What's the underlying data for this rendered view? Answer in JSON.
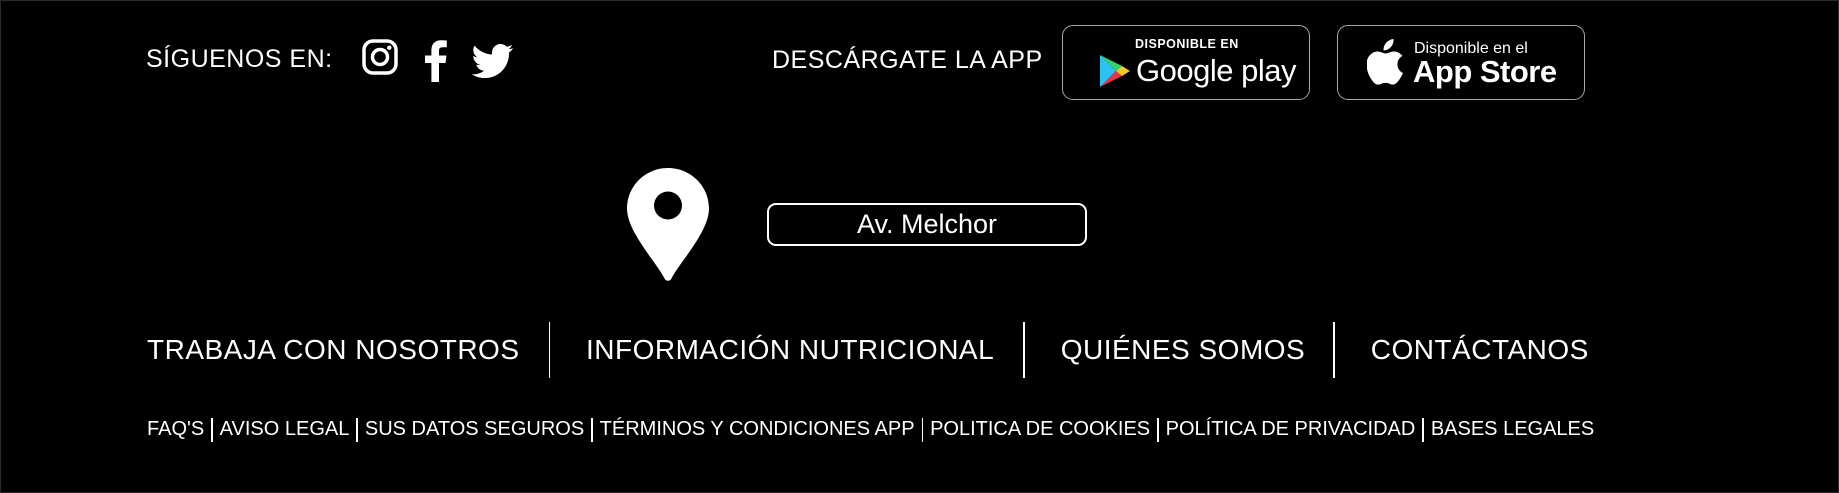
{
  "social": {
    "label": "SÍGUENOS EN:",
    "icons": [
      "instagram-icon",
      "facebook-icon",
      "twitter-icon"
    ]
  },
  "app": {
    "label": "DESCÁRGATE LA APP",
    "google_play": {
      "small": "DISPONIBLE EN",
      "big": "Google play"
    },
    "app_store": {
      "small": "Disponible en el",
      "big": "App Store"
    }
  },
  "location": {
    "icon": "map-pin-icon",
    "address_value": "Av. Melchor"
  },
  "main_nav": [
    "TRABAJA CON NOSOTROS",
    "INFORMACIÓN NUTRICIONAL",
    "QUIÉNES SOMOS",
    "CONTÁCTANOS"
  ],
  "legal_nav": [
    "FAQ'S",
    "AVISO LEGAL",
    "SUS DATOS SEGUROS",
    "TÉRMINOS Y CONDICIONES APP",
    "POLITICA DE COOKIES",
    "POLÍTICA DE PRIVACIDAD",
    "BASES LEGALES"
  ],
  "colors": {
    "background": "#000000",
    "text": "#ffffff",
    "badge_border": "#a6a6a6"
  }
}
